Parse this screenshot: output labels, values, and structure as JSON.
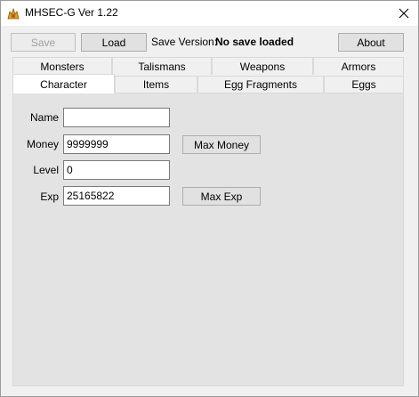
{
  "window": {
    "title": "MHSEC-G Ver 1.22"
  },
  "toolbar": {
    "save_label": "Save",
    "load_label": "Load",
    "save_version_label": "Save Version:",
    "save_version_value": "No save loaded",
    "about_label": "About"
  },
  "tabs_row1": [
    "Monsters",
    "Talismans",
    "Weapons",
    "Armors"
  ],
  "tabs_row2": [
    "Character",
    "Items",
    "Egg Fragments",
    "Eggs"
  ],
  "active_tab": "Character",
  "character": {
    "name_label": "Name",
    "name_value": "",
    "money_label": "Money",
    "money_value": "9999999",
    "max_money_label": "Max Money",
    "level_label": "Level",
    "level_value": "0",
    "exp_label": "Exp",
    "exp_value": "25165822",
    "max_exp_label": "Max Exp"
  }
}
